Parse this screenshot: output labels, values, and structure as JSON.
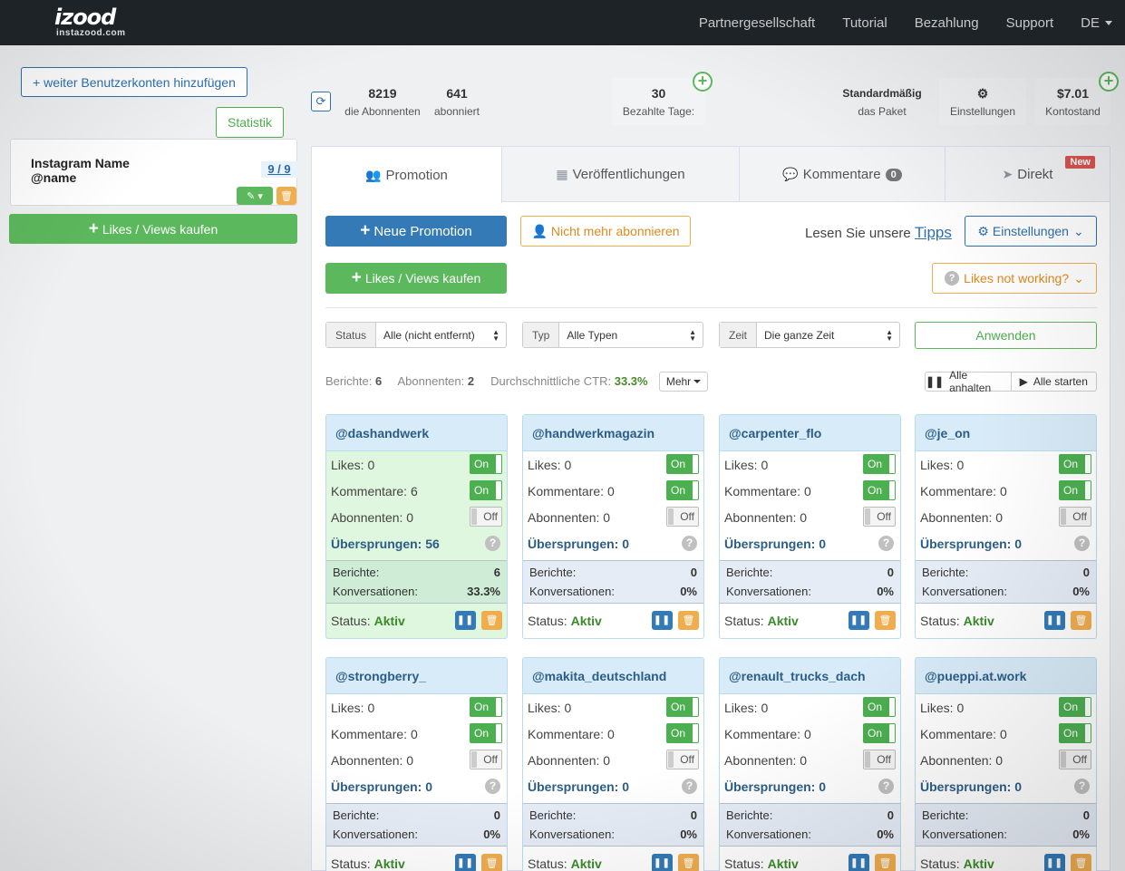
{
  "nav": {
    "logo": "izood",
    "logo_sub": "instazood.com",
    "links": [
      "Partnergesellschaft",
      "Tutorial",
      "Bezahlung",
      "Support"
    ],
    "lang": "DE"
  },
  "left": {
    "add_account": "+ weiter Benutzerkonten hinzufügen",
    "statistik": "Statistik",
    "account_name": "Instagram Name",
    "account_handle": "@name",
    "account_count": "9 / 9",
    "buy": "Likes / Views kaufen"
  },
  "stats": {
    "followers_val": "8219",
    "followers_lbl": "die Abonnenten",
    "following_val": "641",
    "following_lbl": "abonniert",
    "paid_val": "30",
    "paid_lbl": "Bezahlte Tage:",
    "package_val": "Standardmäßig",
    "package_lbl": "das Paket",
    "settings_lbl": "Einstellungen",
    "balance_val": "$7.01",
    "balance_lbl": "Kontostand"
  },
  "tabs": {
    "promotion": "Promotion",
    "posts": "Veröffentlichungen",
    "comments": "Kommentare",
    "comments_count": "0",
    "direct": "Direkt",
    "new_badge": "New"
  },
  "actions": {
    "new_promo": "Neue Promotion",
    "unsubscribe": "Nicht mehr abonnieren",
    "tips_prefix": "Lesen Sie unsere",
    "tips_link": "Tipps",
    "settings": "Einstellungen",
    "buy": "Likes / Views kaufen",
    "likes_not_working": "Likes not working?"
  },
  "filters": {
    "status_label": "Status",
    "status_value": "Alle (nicht entfernt)",
    "type_label": "Typ",
    "type_value": "Alle Typen",
    "time_label": "Zeit",
    "time_value": "Die ganze Zeit",
    "apply": "Anwenden"
  },
  "summary": {
    "reports_label": "Berichte:",
    "reports": "6",
    "followers_label": "Abonnenten:",
    "followers": "2",
    "ctr_label": "Durchschnittliche CTR:",
    "ctr": "33.3%",
    "more": "Mehr",
    "pause_all": "Alle anhalten",
    "start_all": "Alle starten"
  },
  "labels": {
    "likes": "Likes:",
    "comments": "Kommentare:",
    "followers": "Abonnenten:",
    "skipped": "Übersprungen:",
    "reports": "Berichte:",
    "conversions": "Konversationen:",
    "status": "Status:",
    "active": "Aktiv",
    "on": "On",
    "off": "Off"
  },
  "cards": [
    {
      "name": "@dashandwerk",
      "likes": "0",
      "comments": "6",
      "followers": "0",
      "skipped": "56",
      "reports": "6",
      "conv": "33.3%",
      "likes_on": true,
      "comments_on": true,
      "followers_on": false,
      "highlight": true
    },
    {
      "name": "@handwerkmagazin",
      "likes": "0",
      "comments": "0",
      "followers": "0",
      "skipped": "0",
      "reports": "0",
      "conv": "0%",
      "likes_on": true,
      "comments_on": true,
      "followers_on": false,
      "highlight": false
    },
    {
      "name": "@carpenter_flo",
      "likes": "0",
      "comments": "0",
      "followers": "0",
      "skipped": "0",
      "reports": "0",
      "conv": "0%",
      "likes_on": true,
      "comments_on": true,
      "followers_on": false,
      "highlight": false
    },
    {
      "name": "@je_on",
      "likes": "0",
      "comments": "0",
      "followers": "0",
      "skipped": "0",
      "reports": "0",
      "conv": "0%",
      "likes_on": true,
      "comments_on": true,
      "followers_on": false,
      "highlight": false
    },
    {
      "name": "@strongberry_",
      "likes": "0",
      "comments": "0",
      "followers": "0",
      "skipped": "0",
      "reports": "0",
      "conv": "0%",
      "likes_on": true,
      "comments_on": true,
      "followers_on": false,
      "highlight": false
    },
    {
      "name": "@makita_deutschland",
      "likes": "0",
      "comments": "0",
      "followers": "0",
      "skipped": "0",
      "reports": "0",
      "conv": "0%",
      "likes_on": true,
      "comments_on": true,
      "followers_on": false,
      "highlight": false
    },
    {
      "name": "@renault_trucks_dach",
      "likes": "0",
      "comments": "0",
      "followers": "0",
      "skipped": "0",
      "reports": "0",
      "conv": "0%",
      "likes_on": true,
      "comments_on": true,
      "followers_on": false,
      "highlight": false
    },
    {
      "name": "@pueppi.at.work",
      "likes": "0",
      "comments": "0",
      "followers": "0",
      "skipped": "0",
      "reports": "0",
      "conv": "0%",
      "likes_on": true,
      "comments_on": true,
      "followers_on": false,
      "highlight": false
    }
  ]
}
